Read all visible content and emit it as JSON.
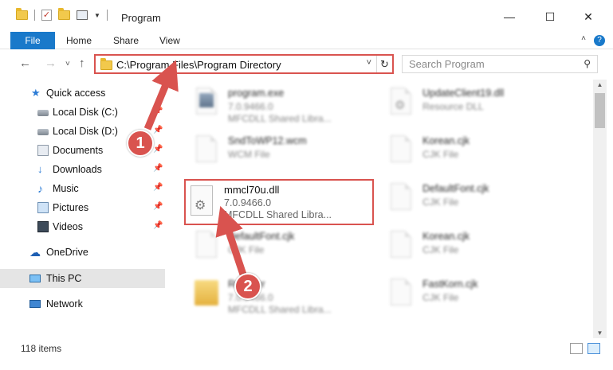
{
  "window": {
    "title": "Program",
    "minimize_glyph": "—",
    "maximize_glyph": "☐",
    "close_glyph": "✕"
  },
  "ribbon": {
    "tabs": [
      "File",
      "Home",
      "Share",
      "View"
    ],
    "help_glyph": "?",
    "collapse_glyph": "˄"
  },
  "nav": {
    "back_glyph": "←",
    "forward_glyph": "→",
    "recent_glyph": "˅",
    "up_glyph": "↑"
  },
  "address": {
    "path": "C:\\Program Files\\Program Directory",
    "dropdown_glyph": "˅",
    "refresh_glyph": "↻"
  },
  "search": {
    "placeholder": "Search Program",
    "icon_glyph": "⚲"
  },
  "sidebar": {
    "items": [
      {
        "label": "Quick access",
        "icon": "star-icon",
        "pinned": false
      },
      {
        "label": "Local Disk (C:)",
        "icon": "drive-icon",
        "pinned": true
      },
      {
        "label": "Local Disk (D:)",
        "icon": "drive-icon",
        "pinned": true
      },
      {
        "label": "Documents",
        "icon": "documents-icon",
        "pinned": true
      },
      {
        "label": "Downloads",
        "icon": "download-icon",
        "pinned": true
      },
      {
        "label": "Music",
        "icon": "music-icon",
        "pinned": true
      },
      {
        "label": "Pictures",
        "icon": "pictures-icon",
        "pinned": true
      },
      {
        "label": "Videos",
        "icon": "videos-icon",
        "pinned": true
      },
      {
        "label": "OneDrive",
        "icon": "cloud-icon",
        "pinned": false
      },
      {
        "label": "This PC",
        "icon": "pc-icon",
        "pinned": false
      },
      {
        "label": "Network",
        "icon": "network-icon",
        "pinned": false
      }
    ],
    "pin_glyph": "📌"
  },
  "files": [
    {
      "name": "program.exe",
      "version": "7.0.9466.0",
      "desc": "MFCDLL Shared Libra..."
    },
    {
      "name": "UpdateClient19.dll",
      "version": "Resource DLL",
      "desc": ""
    },
    {
      "name": "SndToWP12.wcm",
      "version": "WCM File",
      "desc": ""
    },
    {
      "name": "Korean.cjk",
      "version": "CJK File",
      "desc": ""
    },
    {
      "name": "DefaultFont.cjk",
      "version": "CJK File",
      "desc": ""
    },
    {
      "name": "DefaultFont.cjk",
      "version": "CJK File",
      "desc": ""
    },
    {
      "name": "Korean.cjk",
      "version": "CJK File",
      "desc": ""
    },
    {
      "name": "Register",
      "version": "7.0.9466.0",
      "desc": "MFCDLL Shared Libra..."
    },
    {
      "name": "FastKorn.cjk",
      "version": "CJK File",
      "desc": ""
    }
  ],
  "highlighted_file": {
    "name": "mmcl70u.dll",
    "version": "7.0.9466.0",
    "desc": "MFCDLL Shared Libra..."
  },
  "markers": [
    "1",
    "2"
  ],
  "status": {
    "item_count": "118 items"
  },
  "scroll": {
    "up_glyph": "▲",
    "down_glyph": "▼"
  },
  "colors": {
    "accent": "#1979ca",
    "highlight_border": "#d9534f",
    "selected_nav": "#cde8ff"
  }
}
